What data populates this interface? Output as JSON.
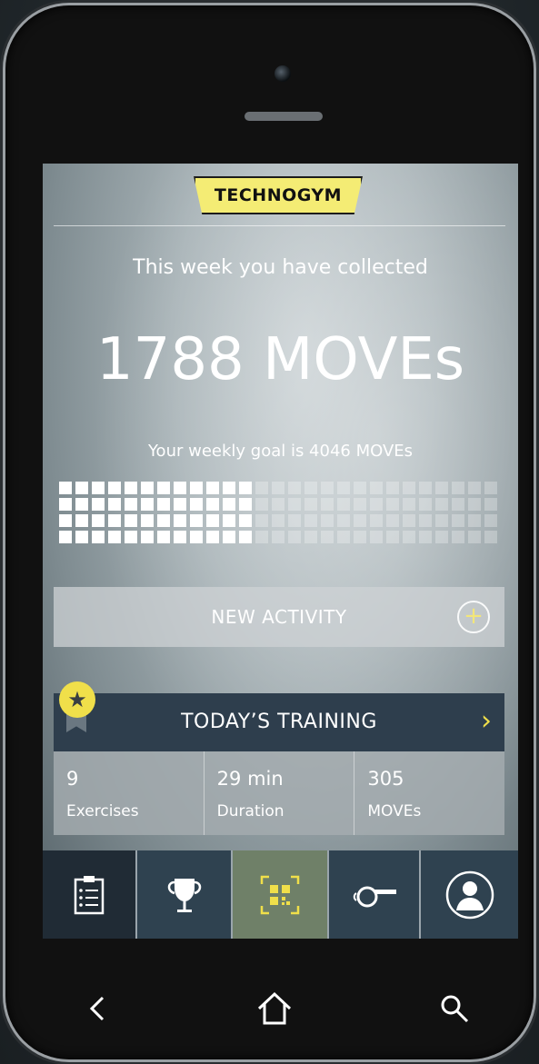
{
  "brand": {
    "logo_text": "TECHNOGYM"
  },
  "summary": {
    "headline": "This week you have collected",
    "moves_collected": "1788 MOVEs",
    "goal_text": "Your weekly goal is 4046 MOVEs",
    "progress_fraction": 0.44
  },
  "actions": {
    "new_activity_label": "NEW ACTIVITY",
    "new_activity_icon": "plus-circle-icon"
  },
  "training": {
    "title": "TODAY’S TRAINING",
    "badge_icon": "star-icon",
    "stats": [
      {
        "value": "9",
        "caption": "Exercises"
      },
      {
        "value": "29 min",
        "caption": "Duration"
      },
      {
        "value": "305",
        "caption": "MOVEs"
      }
    ]
  },
  "tabs": [
    {
      "icon": "checklist-icon",
      "active": true
    },
    {
      "icon": "trophy-icon"
    },
    {
      "icon": "qr-scan-icon"
    },
    {
      "icon": "whistle-icon"
    },
    {
      "icon": "profile-icon"
    }
  ],
  "system_nav": [
    "back-icon",
    "home-icon",
    "search-icon"
  ],
  "colors": {
    "accent_yellow": "#f0df4a",
    "tab_dark": "#2f4250",
    "tab_active": "#202b35",
    "tab_qr": "#6f8068"
  }
}
